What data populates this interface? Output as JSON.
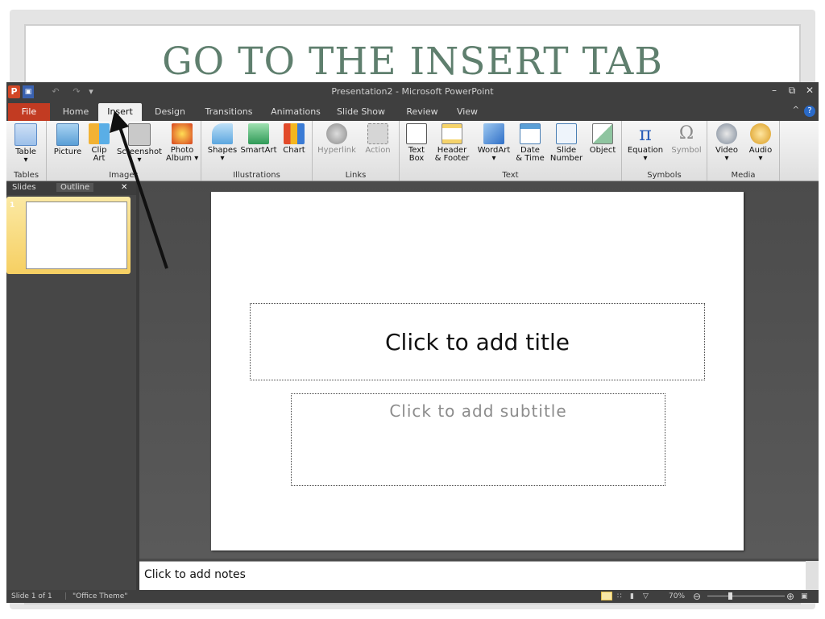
{
  "slide_heading": "GO TO THE INSERT TAB",
  "window": {
    "title": "Presentation2 - Microsoft PowerPoint",
    "app_icon": "P",
    "minimize": "–",
    "restore": "⧉",
    "close": "✕",
    "help": "?",
    "ribbon_minimize": "^"
  },
  "tabs": [
    {
      "label": "File"
    },
    {
      "label": "Home"
    },
    {
      "label": "Insert",
      "active": true
    },
    {
      "label": "Design"
    },
    {
      "label": "Transitions"
    },
    {
      "label": "Animations"
    },
    {
      "label": "Slide Show"
    },
    {
      "label": "Review"
    },
    {
      "label": "View"
    }
  ],
  "ribbon": {
    "groups": [
      {
        "label": "Tables",
        "buttons": [
          {
            "label": "Table",
            "sub": "▾",
            "icon": "table-icon"
          }
        ]
      },
      {
        "label": "Images",
        "buttons": [
          {
            "label": "Picture",
            "sub": "",
            "icon": "picture-icon"
          },
          {
            "label": "Clip",
            "sub": "Art",
            "icon": "clip-art-icon"
          },
          {
            "label": "Screenshot",
            "sub": "▾",
            "icon": "screenshot-icon"
          },
          {
            "label": "Photo",
            "sub": "Album ▾",
            "icon": "photo-album-icon"
          }
        ]
      },
      {
        "label": "Illustrations",
        "buttons": [
          {
            "label": "Shapes",
            "sub": "▾",
            "icon": "shapes-icon"
          },
          {
            "label": "SmartArt",
            "sub": "",
            "icon": "smartart-icon"
          },
          {
            "label": "Chart",
            "sub": "",
            "icon": "chart-icon"
          }
        ]
      },
      {
        "label": "Links",
        "buttons": [
          {
            "label": "Hyperlink",
            "sub": "",
            "icon": "hyperlink-icon",
            "disabled": true
          },
          {
            "label": "Action",
            "sub": "",
            "icon": "action-icon",
            "disabled": true
          }
        ]
      },
      {
        "label": "Text",
        "buttons": [
          {
            "label": "Text",
            "sub": "Box",
            "icon": "text-box-icon"
          },
          {
            "label": "Header",
            "sub": "& Footer",
            "icon": "header-footer-icon"
          },
          {
            "label": "WordArt",
            "sub": "▾",
            "icon": "wordart-icon"
          },
          {
            "label": "Date",
            "sub": "& Time",
            "icon": "date-time-icon"
          },
          {
            "label": "Slide",
            "sub": "Number",
            "icon": "slide-number-icon"
          },
          {
            "label": "Object",
            "sub": "",
            "icon": "object-icon"
          }
        ]
      },
      {
        "label": "Symbols",
        "buttons": [
          {
            "label": "Equation",
            "sub": "▾",
            "icon": "equation-icon"
          },
          {
            "label": "Symbol",
            "sub": "",
            "icon": "symbol-icon",
            "disabled": true
          }
        ]
      },
      {
        "label": "Media",
        "buttons": [
          {
            "label": "Video",
            "sub": "▾",
            "icon": "video-icon"
          },
          {
            "label": "Audio",
            "sub": "▾",
            "icon": "audio-icon"
          }
        ]
      }
    ]
  },
  "slides_pane": {
    "tab_slides": "Slides",
    "tab_outline": "Outline",
    "close": "✕",
    "thumbnail_number": "1"
  },
  "slide": {
    "title_placeholder": "Click to add title",
    "subtitle_placeholder": "Click to add subtitle"
  },
  "notes_placeholder": "Click to add notes",
  "status": {
    "slide_info": "Slide 1 of 1",
    "theme": "\"Office Theme\"",
    "zoom": "70%"
  },
  "colors": {
    "heading": "#5f7f6e",
    "file_tab": "#c23b22",
    "window_chrome": "#3f3f3f",
    "thumbnail_highlight": "#f6cf62"
  }
}
